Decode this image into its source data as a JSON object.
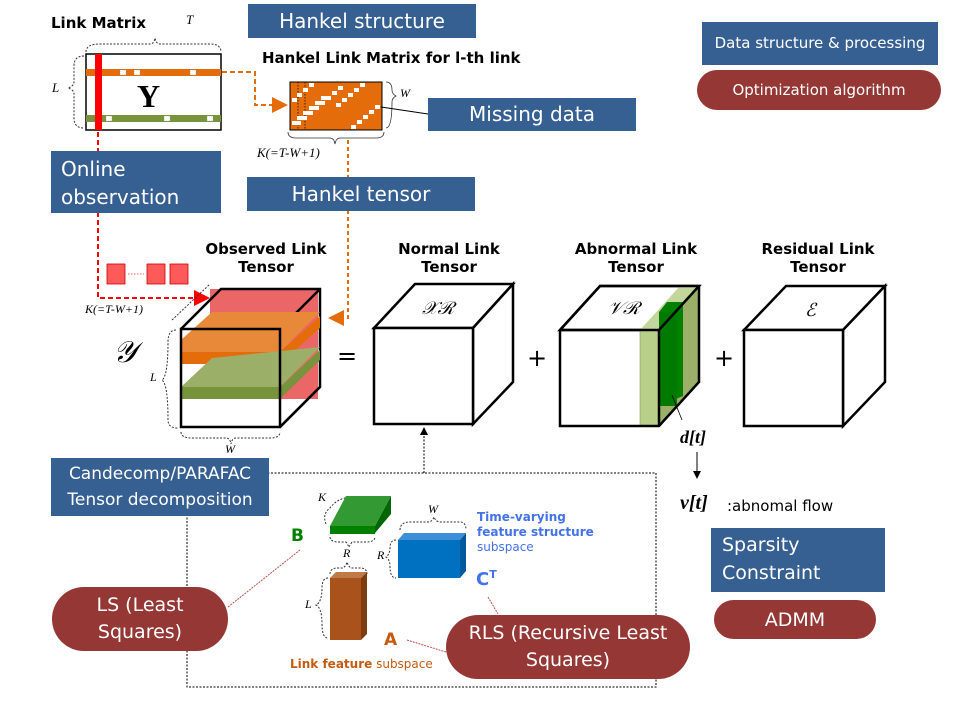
{
  "legend": {
    "data_structure_label": "Data structure & processing",
    "optimization_label": "Optimization algorithm"
  },
  "colors": {
    "data_box": "#376092",
    "algorithm_pill": "#953735",
    "orange_slice": "#E46C0A",
    "green_slice": "#77933C",
    "observation_red": "#FF0000",
    "feature_blue": "#0070C0",
    "feature_green": "#008000",
    "feature_brown": "#A9521B"
  },
  "link_matrix": {
    "title": "Link Matrix",
    "symbol": "Y",
    "dim_rows": "L",
    "dim_cols": "T"
  },
  "hankel": {
    "structure_label": "Hankel structure",
    "matrix_title": "Hankel Link Matrix for l-th link",
    "dim_rows": "W",
    "dim_cols": "K(=T-W+1)",
    "missing_data_label": "Missing data",
    "tensor_label": "Hankel tensor"
  },
  "online_observation": {
    "label_line1": "Online",
    "label_line2": "observation"
  },
  "tensors": {
    "observed": {
      "title_line1": "Observed Link",
      "title_line2": "Tensor",
      "symbol": "𝒴",
      "dim_depth": "K(=T-W+1)",
      "dim_height": "L",
      "dim_width": "W"
    },
    "normal": {
      "title_line1": "Normal Link",
      "title_line2": "Tensor",
      "symbol": "𝒳ℛ"
    },
    "abnormal": {
      "title_line1": "Abnormal Link",
      "title_line2": "Tensor",
      "symbol": "𝒱ℛ",
      "slice_symbol": "d[t]"
    },
    "residual": {
      "title_line1": "Residual Link",
      "title_line2": "Tensor",
      "symbol": "ℰ"
    },
    "equals": "=",
    "plus": "+"
  },
  "abnormal_flow": {
    "symbol": "v[t]",
    "label": ":abnomal flow"
  },
  "decomposition": {
    "label_line1": "Candecomp/PARAFAC",
    "label_line2": "Tensor decomposition",
    "factor_b": {
      "letter": "B",
      "dim_a": "K",
      "dim_b": "R"
    },
    "factor_c": {
      "letter": "C",
      "superscript": "T",
      "dim_a": "W",
      "dim_b": "R",
      "caption_bold_line1": "Time-varying",
      "caption_bold_line2": "feature structure",
      "caption_line3": "subspace"
    },
    "factor_a": {
      "letter": "A",
      "dim_a": "R",
      "dim_b": "L",
      "caption_bold": "Link feature",
      "caption_rest": " subspace"
    }
  },
  "algorithms": {
    "ls_line1": "LS (Least",
    "ls_line2": "Squares)",
    "rls_line1": "RLS (Recursive Least",
    "rls_line2": "Squares)",
    "sparsity_line1": "Sparsity",
    "sparsity_line2": "Constraint",
    "admm": "ADMM"
  }
}
